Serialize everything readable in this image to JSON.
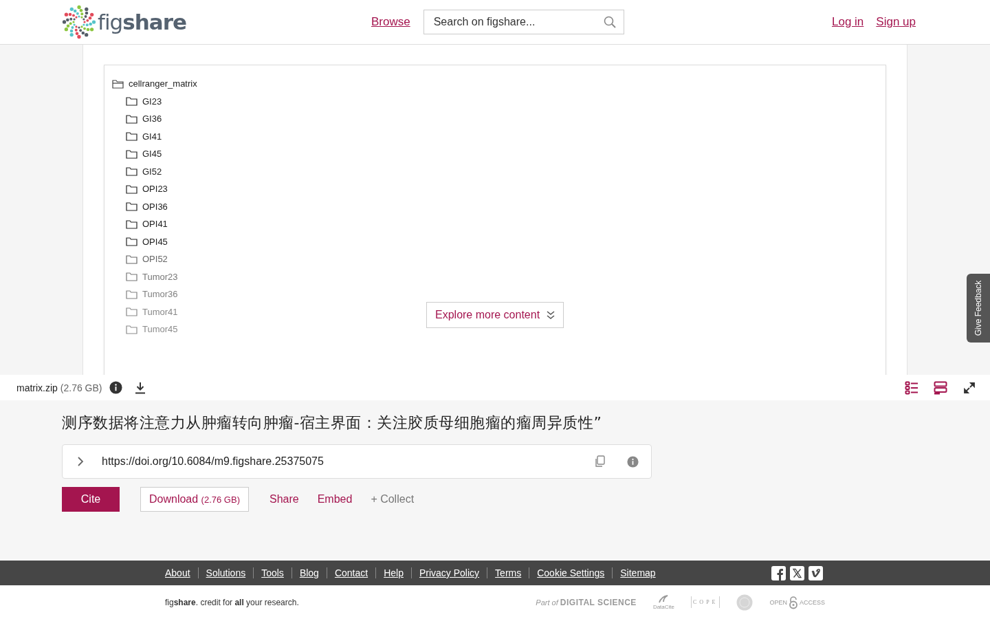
{
  "header": {
    "logo": "figshare",
    "browse": "Browse",
    "search": {
      "placeholder": "Search on figshare..."
    },
    "login": "Log in",
    "signup": "Sign up"
  },
  "tree": {
    "name": "cellranger_matrix",
    "expanded": true,
    "children": [
      {
        "name": "GI23"
      },
      {
        "name": "GI36"
      },
      {
        "name": "GI41"
      },
      {
        "name": "GI45"
      },
      {
        "name": "GI52"
      },
      {
        "name": "OPI23"
      },
      {
        "name": "OPI36"
      },
      {
        "name": "OPI41"
      },
      {
        "name": "OPI45"
      },
      {
        "name": "OPI52"
      },
      {
        "name": "Tumor23"
      },
      {
        "name": "Tumor36"
      },
      {
        "name": "Tumor41"
      },
      {
        "name": "Tumor45"
      }
    ]
  },
  "explore_button": "Explore more content",
  "feedback": "Give Feedback",
  "file": {
    "name": "matrix.zip",
    "size": "(2.76 GB)"
  },
  "title": "测序数据将注意力从肿瘤转向肿瘤-宿主界面：关注胶质母细胞瘤的瘤周异质性”",
  "doi": "https://doi.org/10.6084/m9.figshare.25375075",
  "actions": {
    "cite": "Cite",
    "download": "Download",
    "download_size": "(2.76 GB)",
    "share": "Share",
    "embed": "Embed",
    "collect": "+ Collect"
  },
  "footer_links": [
    "About",
    "Solutions",
    "Tools",
    "Blog",
    "Contact",
    "Help",
    "Privacy Policy",
    "Terms",
    "Cookie Settings",
    "Sitemap"
  ],
  "tagline": "fig**share**. credit for **all** your research.",
  "partners": {
    "digital_science_prefix": "Part of",
    "digital_science": "DIGITAL SCIENCE",
    "datacite": "DataCite",
    "cope": "COPE",
    "open_access_left": "OPEN",
    "open_access_right": "ACCESS"
  }
}
